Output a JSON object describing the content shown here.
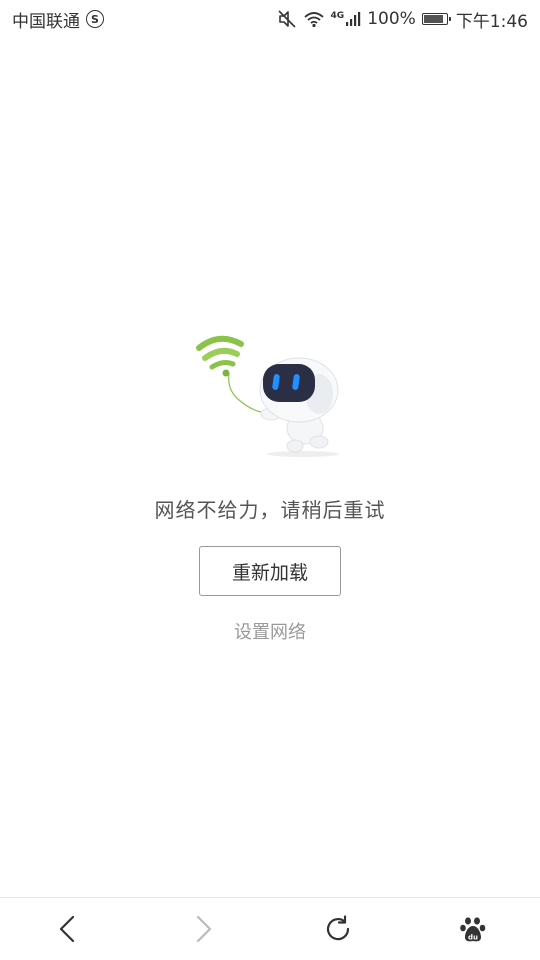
{
  "status_bar": {
    "carrier": "中国联通",
    "carrier_badge": "S",
    "signal_type": "4G",
    "battery_percent": "100%",
    "time": "下午1:46",
    "icons": [
      "mute-icon",
      "wifi-icon",
      "signal-icon",
      "battery-icon"
    ]
  },
  "error": {
    "illustration": "robot-with-wifi-balloon",
    "message": "网络不给力，请稍后重试",
    "reload_label": "重新加载",
    "settings_label": "设置网络"
  },
  "bottom_nav": {
    "items": [
      "back-icon",
      "forward-icon",
      "refresh-icon",
      "baidu-paw-icon"
    ]
  },
  "colors": {
    "text_primary": "#333333",
    "text_secondary": "#9a9a9a",
    "button_border": "#999999",
    "robot_screen": "#2a2f45",
    "robot_eyes": "#1e90ff",
    "wifi_green": "#8bc34a",
    "nav_disabled": "#bbbbbb"
  }
}
